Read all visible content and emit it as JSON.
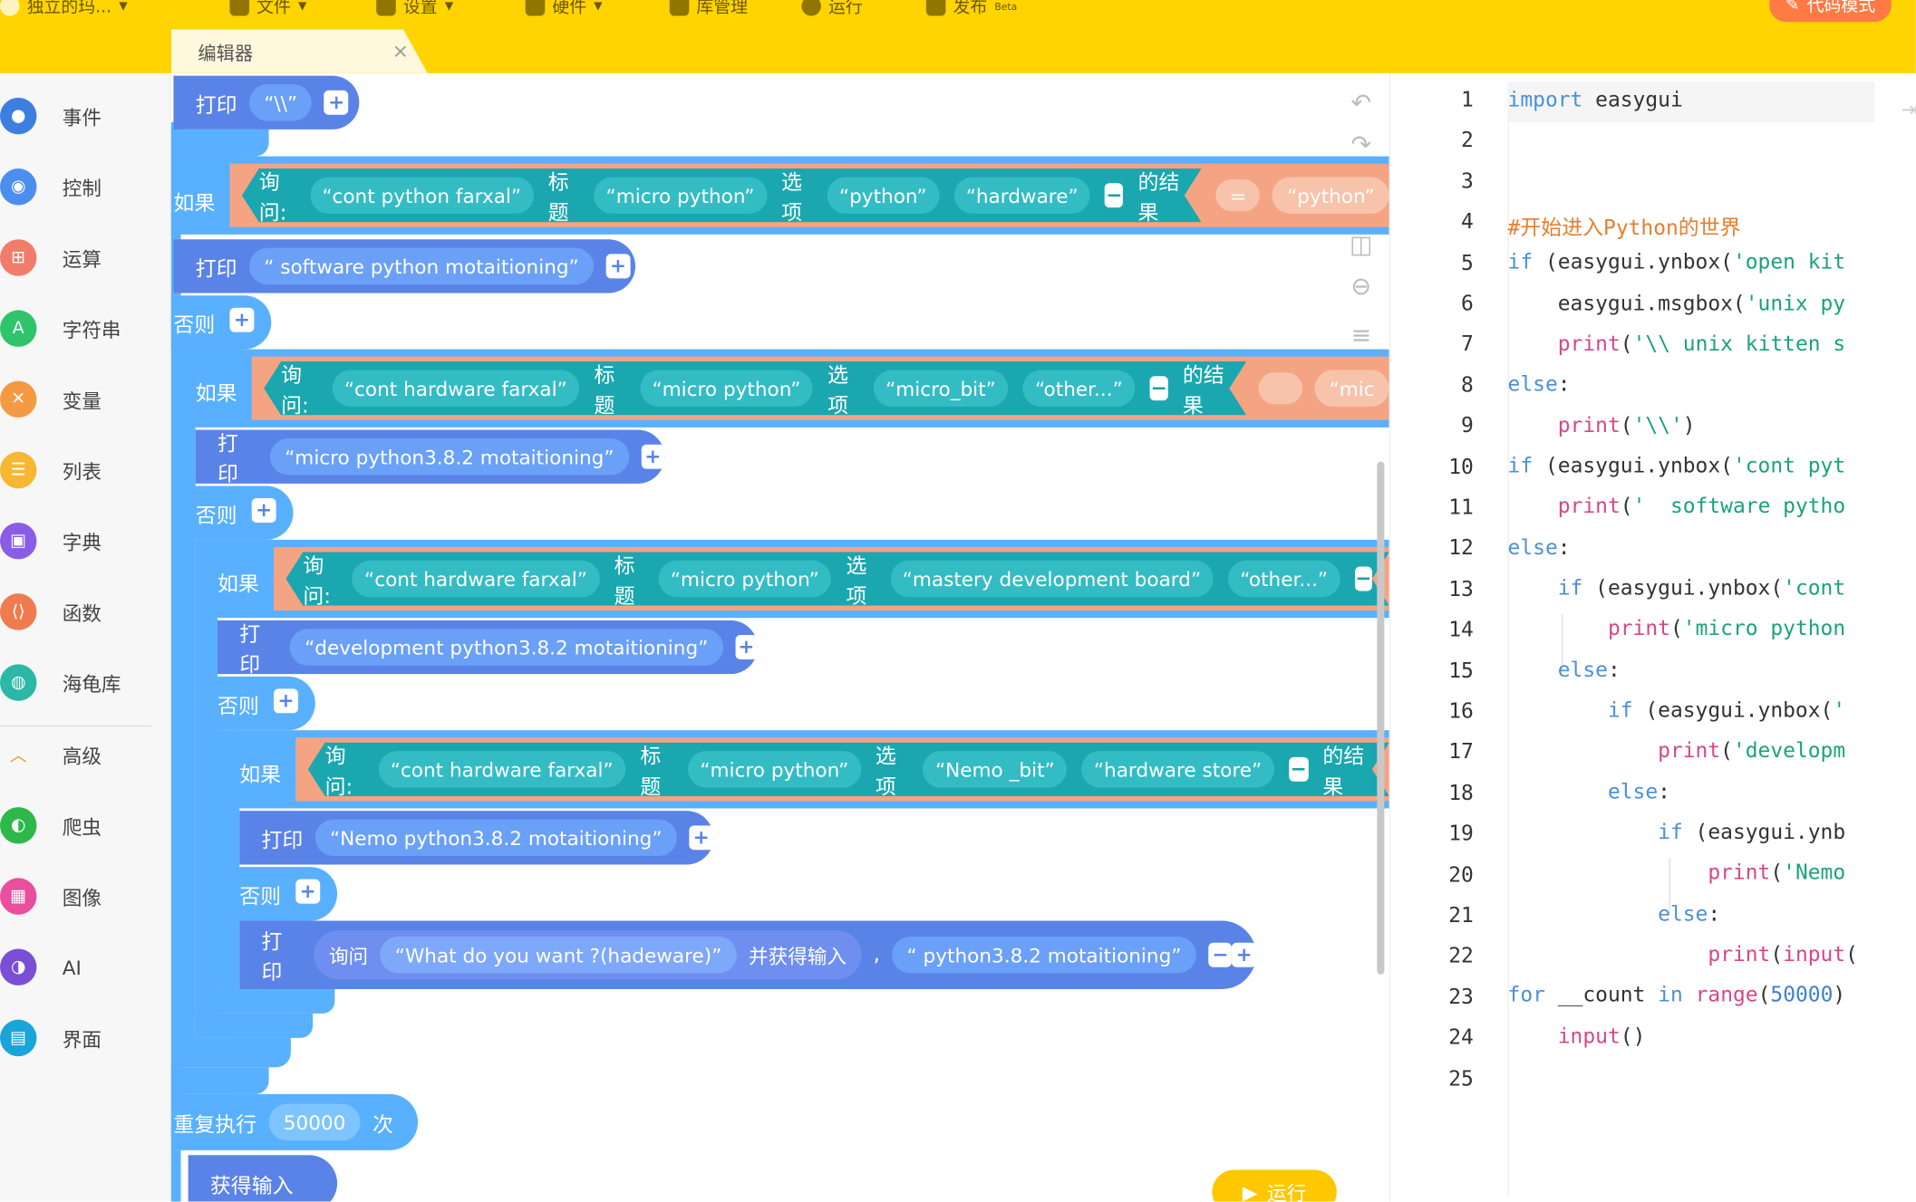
{
  "topbar": {
    "project": "独立的玛...",
    "file": "文件",
    "settings": "设置",
    "hardware": "硬件",
    "library": "库管理",
    "run": "运行",
    "publish": "发布",
    "publish_badge": "Beta",
    "code_mode": "代码模式"
  },
  "editor_tab": {
    "label": "编辑器",
    "close": "×"
  },
  "sidebar": {
    "items": [
      {
        "label": "事件",
        "color": "#3d7fe0"
      },
      {
        "label": "控制",
        "color": "#4a8ff0"
      },
      {
        "label": "运算",
        "color": "#f27c6a"
      },
      {
        "label": "字符串",
        "color": "#2fc46a"
      },
      {
        "label": "变量",
        "color": "#f59a44"
      },
      {
        "label": "列表",
        "color": "#f7b733"
      },
      {
        "label": "字典",
        "color": "#8b5de6"
      },
      {
        "label": "函数",
        "color": "#f07b4f"
      },
      {
        "label": "海龟库",
        "color": "#2bb8a6"
      },
      {
        "label": "高级",
        "color": "#d4a017"
      },
      {
        "label": "爬虫",
        "color": "#2eb84a"
      },
      {
        "label": "图像",
        "color": "#e84f9c"
      },
      {
        "label": "AI",
        "color": "#7a4fd6"
      },
      {
        "label": "界面",
        "color": "#1aa5d9"
      }
    ]
  },
  "blocks": {
    "print1": {
      "kw": "打印",
      "val": "“\\\\”"
    },
    "if": "如果",
    "else": "否则",
    "print": "打印",
    "ask": "询问:",
    "title": "标题",
    "options": "选项",
    "result": "的结果",
    "eq": "=",
    "if1": {
      "q": "“cont python farxal”",
      "t": "“micro python”",
      "o1": "“python”",
      "o2": "“hardware”",
      "cmp": "“python”"
    },
    "print2": "“ software python motaitioning”",
    "if2": {
      "q": "“cont hardware farxal”",
      "t": "“micro python”",
      "o1": "“micro_bit”",
      "o2": "“other...”",
      "cmp": "“mic"
    },
    "print3": "“micro python3.8.2 motaitioning”",
    "if3": {
      "q": "“cont hardware farxal”",
      "t": "“micro python”",
      "o1": "“mastery development board”",
      "o2": "“other...”"
    },
    "print4": "“development python3.8.2 motaitioning”",
    "if4": {
      "q": "“cont hardware farxal”",
      "t": "“micro python”",
      "o1": "“Nemo _bit”",
      "o2": "“hardware store”"
    },
    "print5": "“Nemo python3.8.2 motaitioning”",
    "print6": {
      "ask": "询问",
      "q": "“What do you want ?(hadeware)”",
      "and": "并获得输入",
      "comma": ",",
      "val": "“ python3.8.2 motaitioning”"
    },
    "repeat": {
      "kw": "重复执行",
      "n": "50000",
      "times": "次"
    },
    "getinput": "获得输入",
    "run_button": "运行"
  },
  "code": {
    "line_numbers": [
      "1",
      "2",
      "3",
      "4",
      "5",
      "6",
      "7",
      "8",
      "9",
      "10",
      "11",
      "12",
      "13",
      "14",
      "15",
      "16",
      "17",
      "18",
      "19",
      "20",
      "21",
      "22",
      "23",
      "24",
      "25"
    ]
  }
}
